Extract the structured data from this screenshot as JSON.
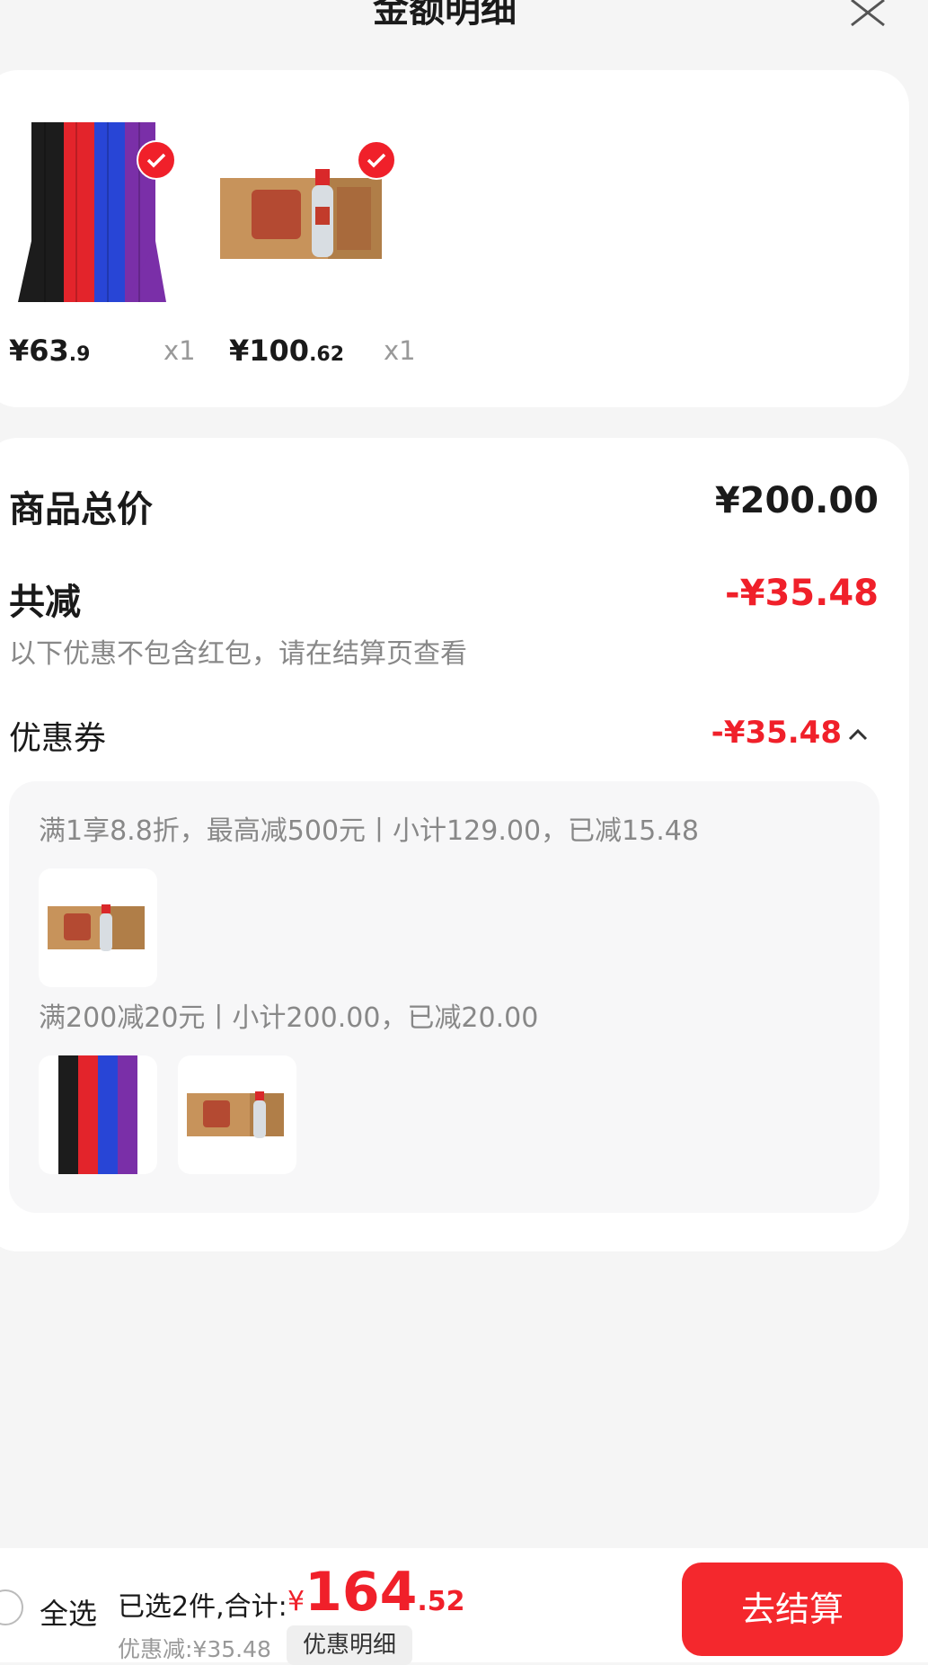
{
  "header": {
    "title": "金额明细"
  },
  "products": [
    {
      "name": "belts",
      "currency": "¥",
      "price_int": "63",
      "price_dec": ".9",
      "qty": "x1",
      "checked": true
    },
    {
      "name": "liquor-box",
      "currency": "¥",
      "price_int": "100",
      "price_dec": ".62",
      "qty": "x1",
      "checked": true
    }
  ],
  "detail": {
    "total_label": "商品总价",
    "total_value": "¥200.00",
    "reduce_label": "共减",
    "reduce_value": "-¥35.48",
    "note": "以下优惠不包含红包，请在结算页查看",
    "coupon_label": "优惠券",
    "coupon_value": "-¥35.48",
    "coupon_rules": [
      {
        "text": "满1享8.8折，最高减500元丨小计129.00，已减15.48"
      },
      {
        "text": "满200减20元丨小计200.00，已减20.00"
      }
    ]
  },
  "bottom": {
    "select_all": "全选",
    "selected_summary": "已选2件,合计:",
    "total_currency": "¥",
    "total_int": "164",
    "total_dec": ".52",
    "discount": "优惠减:¥35.48",
    "detail_tag": "优惠明细",
    "checkout": "去结算"
  },
  "colors": {
    "accent": "#f0202a",
    "background": "#f5f5f5",
    "card": "#ffffff"
  }
}
